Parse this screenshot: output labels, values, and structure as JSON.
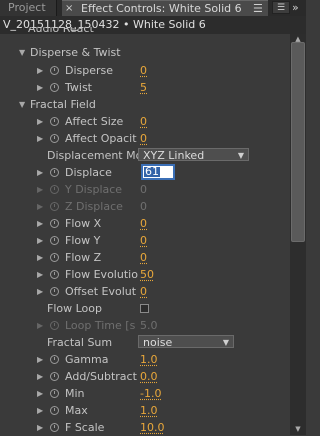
{
  "tabs": {
    "project": "Project",
    "effect_controls": "Effect Controls: White Solid 6"
  },
  "layer_title": "V_20151128_150432 • White Solid 6",
  "partial_header": "Audio React",
  "groups": {
    "disperse_twist": "Disperse & Twist",
    "fractal_field": "Fractal Field"
  },
  "props": {
    "disperse": {
      "label": "Disperse",
      "value": "0"
    },
    "twist": {
      "label": "Twist",
      "value": "5"
    },
    "affect_size": {
      "label": "Affect Size",
      "value": "0"
    },
    "affect_opacity": {
      "label": "Affect Opacit",
      "value": "0"
    },
    "displacement_mode": {
      "label": "Displacement Mo",
      "value": "XYZ Linked"
    },
    "displace": {
      "label": "Displace",
      "value": "61"
    },
    "y_displace": {
      "label": "Y Displace",
      "value": "0"
    },
    "z_displace": {
      "label": "Z Displace",
      "value": "0"
    },
    "flow_x": {
      "label": "Flow X",
      "value": "0"
    },
    "flow_y": {
      "label": "Flow Y",
      "value": "0"
    },
    "flow_z": {
      "label": "Flow Z",
      "value": "0"
    },
    "flow_evolution": {
      "label": "Flow Evolutio",
      "value": "50"
    },
    "offset_evolution": {
      "label": "Offset Evolut",
      "value": "0"
    },
    "flow_loop": {
      "label": "Flow Loop",
      "checked": false
    },
    "loop_time": {
      "label": "Loop Time [s",
      "value": "5.0"
    },
    "fractal_sum": {
      "label": "Fractal Sum",
      "value": "noise"
    },
    "gamma": {
      "label": "Gamma",
      "value": "1.0"
    },
    "add_subtract": {
      "label": "Add/Subtract",
      "value": "0.0"
    },
    "min": {
      "label": "Min",
      "value": "-1.0"
    },
    "max": {
      "label": "Max",
      "value": "1.0"
    },
    "f_scale": {
      "label": "F Scale",
      "value": "10.0"
    }
  },
  "icons": {
    "close": "×",
    "panel_menu": "☰",
    "more": "»",
    "expanded": "▼",
    "collapsed": "▶",
    "stopwatch": "stopwatch-icon"
  },
  "colors": {
    "value": "#e8a73a",
    "disabled": "#6f6f6f",
    "selection": "#3363a8"
  }
}
